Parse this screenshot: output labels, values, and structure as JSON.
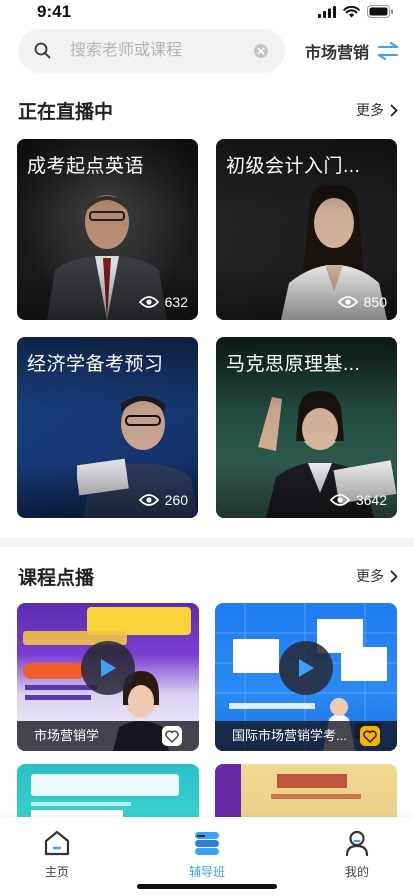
{
  "status_bar": {
    "time": "9:41"
  },
  "search": {
    "placeholder": "搜索老师或课程",
    "category_label": "市场营销"
  },
  "live_section": {
    "title": "正在直播中",
    "more_label": "更多",
    "cards": [
      {
        "title": "成考起点英语",
        "viewers": "632"
      },
      {
        "title": "初级会计入门...",
        "viewers": "850"
      },
      {
        "title": "经济学备考预习",
        "viewers": "260"
      },
      {
        "title": "马克思原理基...",
        "viewers": "3642"
      }
    ]
  },
  "course_section": {
    "title": "课程点播",
    "more_label": "更多",
    "cards": [
      {
        "title": "市场营销学",
        "favorited": false
      },
      {
        "title": "国际市场营销学考...",
        "favorited": true
      }
    ]
  },
  "tab_bar": {
    "tabs": [
      {
        "label": "主页",
        "icon": "home-icon",
        "active": false
      },
      {
        "label": "辅导班",
        "icon": "class-icon",
        "active": true
      },
      {
        "label": "我的",
        "icon": "profile-icon",
        "active": false
      }
    ]
  },
  "colors": {
    "accent": "#3aa1f6",
    "favorite": "#f6b400"
  }
}
